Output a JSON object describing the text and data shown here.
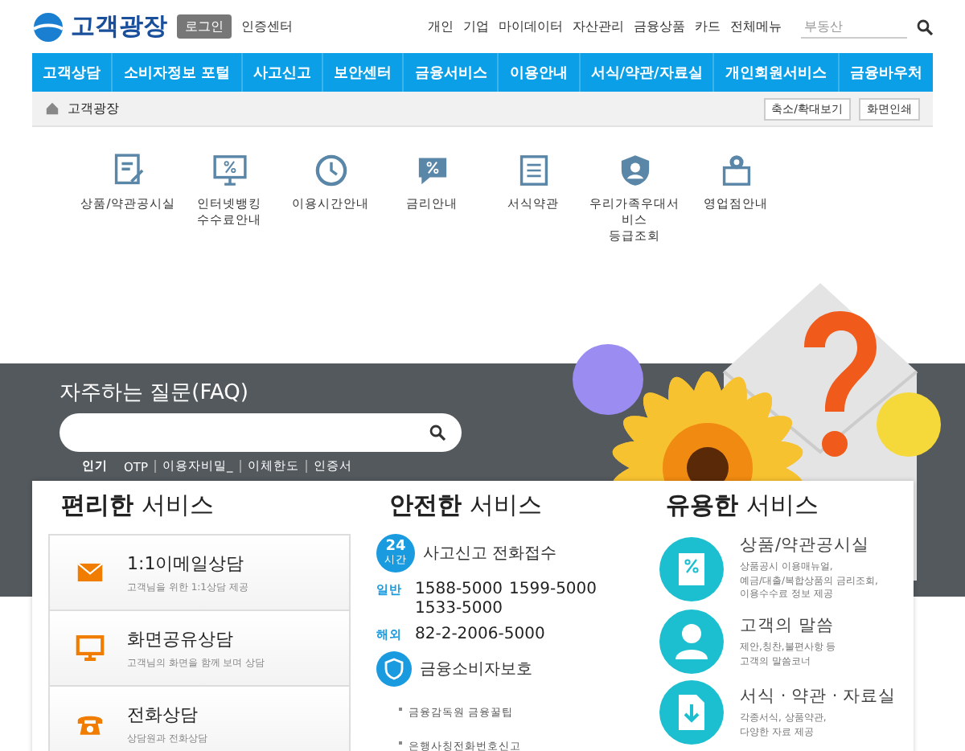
{
  "header": {
    "logo": "고객광장",
    "login_button": "로그인",
    "cert_link": "인증센터",
    "top_links": [
      "개인",
      "기업",
      "마이데이터",
      "자산관리",
      "금융상품",
      "카드",
      "전체메뉴"
    ],
    "search": {
      "placeholder": "부동산"
    }
  },
  "nav": [
    "고객상담",
    "소비자정보 포털",
    "사고신고",
    "보안센터",
    "금융서비스",
    "이용안내",
    "서식/약관/자료실",
    "개인회원서비스",
    "금융바우처"
  ],
  "breadcrumb": {
    "current": "고객광장",
    "buttons": [
      "축소/확대보기",
      "화면인쇄"
    ]
  },
  "quick_menu": [
    {
      "kind": "document",
      "label": "상품/약관공시실"
    },
    {
      "kind": "monitor",
      "label": "인터넷뱅킹\n수수료안내"
    },
    {
      "kind": "clock",
      "label": "이용시간안내"
    },
    {
      "kind": "percent",
      "label": "금리안내"
    },
    {
      "kind": "form",
      "label": "서식약관"
    },
    {
      "kind": "shield",
      "label": "우리가족우대서비스\n등급조회"
    },
    {
      "kind": "pin",
      "label": "영업점안내"
    }
  ],
  "faq": {
    "title": "자주하는 질문(FAQ)",
    "popular_label": "인기",
    "tags": [
      "OTP",
      "이용자비밀_",
      "이체한도",
      "인증서"
    ]
  },
  "convenient": {
    "title": "**편리한** 서비스",
    "items": [
      {
        "kind": "mail",
        "title": "1:1이메일상담",
        "desc": "고객님을 위한 1:1상담 제공"
      },
      {
        "kind": "monitor",
        "title": "화면공유상담",
        "desc": "고객님의 화면을 함께 보며 상담"
      },
      {
        "kind": "phone",
        "title": "전화상담",
        "desc": "상담원과 전화상담"
      }
    ]
  },
  "safe": {
    "title": "**안전한** 서비스",
    "badge_number": "24",
    "badge_unit": "시간",
    "report_title": "사고신고 전화접수",
    "phones": [
      {
        "label": "일반",
        "numbers": [
          "1588-5000",
          "1599-5000",
          "1533-5000"
        ]
      },
      {
        "label": "해외",
        "numbers": [
          "82-2-2006-5000"
        ]
      }
    ],
    "protection_title": "금융소비자보호",
    "protection_links": [
      "금융감독원 금융꿀팁",
      "은행사칭전화번호신고"
    ]
  },
  "useful": {
    "title": "**유용한** 서비스",
    "items": [
      {
        "kind": "percent-doc",
        "title": "상품/약관공시실",
        "desc": "상품공시 이용매뉴얼,\n예금/대출/복합상품의 금리조회,\n이용수수료 정보 제공"
      },
      {
        "kind": "person",
        "title": "고객의 말씀",
        "desc": "제안,칭찬,불편사항 등\n고객의 말씀코너"
      },
      {
        "kind": "download",
        "title": "서식 · 약관 · 자료실",
        "desc": "각종서식, 상품약관,\n다양한 자료 제공"
      }
    ]
  }
}
